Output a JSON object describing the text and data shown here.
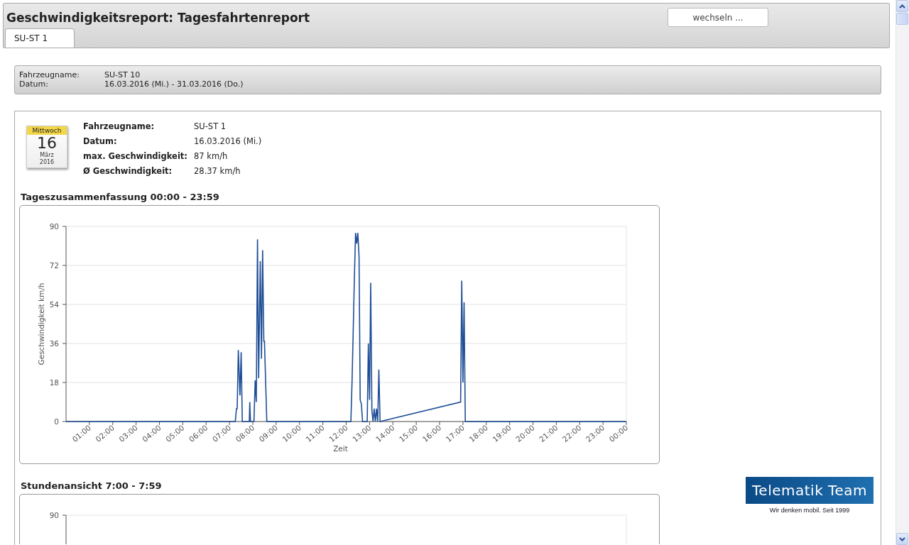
{
  "header": {
    "title": "Geschwindigkeitsreport: Tagesfahrtenreport",
    "switch_button": "wechseln ..."
  },
  "tabs": [
    {
      "label": "SU-ST 1",
      "selected": true
    }
  ],
  "summary": [
    {
      "label": "Fahrzeugname:",
      "value": "SU-ST 10"
    },
    {
      "label": "Datum:",
      "value": "16.03.2016 (Mi.) - 31.03.2016 (Do.)"
    }
  ],
  "day": {
    "calendar": {
      "weekday": "Mittwoch",
      "day": "16",
      "month": "März",
      "year": "2016"
    },
    "details": [
      {
        "label": "Fahrzeugname:",
        "value": "SU-ST 1"
      },
      {
        "label": "Datum:",
        "value": "16.03.2016 (Mi.)"
      },
      {
        "label": "max. Geschwindigkeit:",
        "value": "87 km/h"
      },
      {
        "label": "Ø Geschwindigkeit:",
        "value": "28.37 km/h"
      }
    ]
  },
  "daily_summary": {
    "heading": "Tageszusammenfassung 00:00 - 23:59",
    "chart_data": {
      "type": "line",
      "xlabel": "Zeit",
      "ylabel": "Geschwindigkeit km/h",
      "xlim": [
        0,
        24
      ],
      "ylim": [
        0,
        90
      ],
      "yticks": [
        0,
        18,
        36,
        54,
        72,
        90
      ],
      "xticks": [
        {
          "value": 1,
          "label": "01:00"
        },
        {
          "value": 2,
          "label": "02:00"
        },
        {
          "value": 3,
          "label": "03:00"
        },
        {
          "value": 4,
          "label": "04:00"
        },
        {
          "value": 5,
          "label": "05:00"
        },
        {
          "value": 6,
          "label": "06:00"
        },
        {
          "value": 7,
          "label": "07:00"
        },
        {
          "value": 8,
          "label": "08:00"
        },
        {
          "value": 9,
          "label": "09:00"
        },
        {
          "value": 10,
          "label": "10:00"
        },
        {
          "value": 11,
          "label": "11:00"
        },
        {
          "value": 12,
          "label": "12:00"
        },
        {
          "value": 13,
          "label": "13:00"
        },
        {
          "value": 14,
          "label": "14:00"
        },
        {
          "value": 15,
          "label": "15:00"
        },
        {
          "value": 16,
          "label": "16:00"
        },
        {
          "value": 17,
          "label": "17:00"
        },
        {
          "value": 18,
          "label": "18:00"
        },
        {
          "value": 19,
          "label": "19:00"
        },
        {
          "value": 20,
          "label": "20:00"
        },
        {
          "value": 21,
          "label": "21:00"
        },
        {
          "value": 22,
          "label": "22:00"
        },
        {
          "value": 23,
          "label": "23:00"
        },
        {
          "value": 24,
          "label": "00:00"
        }
      ],
      "x": [
        0,
        7.25,
        7.3,
        7.33,
        7.38,
        7.45,
        7.5,
        7.55,
        7.85,
        7.87,
        7.9,
        8.05,
        8.1,
        8.15,
        8.2,
        8.25,
        8.32,
        8.37,
        8.42,
        8.47,
        8.5,
        8.6,
        12.2,
        12.25,
        12.3,
        12.35,
        12.4,
        12.45,
        12.5,
        12.55,
        12.6,
        12.65,
        12.7,
        12.9,
        12.95,
        13.0,
        13.05,
        13.1,
        13.15,
        13.2,
        13.25,
        13.3,
        13.35,
        13.4,
        13.45,
        16.9,
        16.95,
        17.0,
        17.05,
        17.1,
        24
      ],
      "grid": true,
      "series": [
        {
          "color": "#1f4e96",
          "values": [
            0,
            0,
            6,
            6,
            33,
            12,
            32,
            0,
            0,
            9,
            0,
            0,
            19,
            9,
            84,
            20,
            74,
            29,
            79,
            37,
            37,
            0,
            0,
            18,
            42,
            66,
            87,
            82,
            87,
            76,
            10,
            8,
            0,
            0,
            36,
            10,
            64,
            5,
            0,
            6,
            0,
            6,
            0,
            24,
            0,
            9,
            65,
            18,
            55,
            0,
            0
          ]
        }
      ]
    }
  },
  "hourly_view": {
    "heading": "Stundenansicht 7:00 - 7:59",
    "visible_ytick": "90"
  },
  "logo": {
    "name": "Telematik Team",
    "slogan": "Wir denken mobil. Seit 1999"
  }
}
